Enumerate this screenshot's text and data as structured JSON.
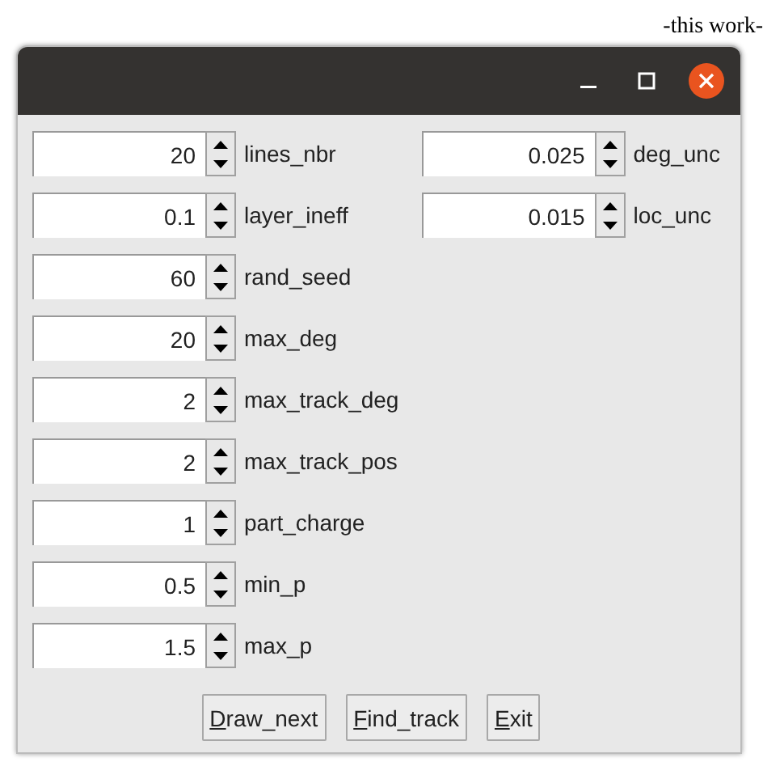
{
  "caption": "-this work-",
  "left_column": [
    {
      "value": "20",
      "label": "lines_nbr"
    },
    {
      "value": "0.1",
      "label": "layer_ineff"
    },
    {
      "value": "60",
      "label": "rand_seed"
    },
    {
      "value": "20",
      "label": "max_deg"
    },
    {
      "value": "2",
      "label": "max_track_deg"
    },
    {
      "value": "2",
      "label": "max_track_pos"
    },
    {
      "value": "1",
      "label": "part_charge"
    },
    {
      "value": "0.5",
      "label": "min_p"
    },
    {
      "value": "1.5",
      "label": "max_p"
    }
  ],
  "right_column": [
    {
      "value": "0.025",
      "label": "deg_unc"
    },
    {
      "value": "0.015",
      "label": "loc_unc"
    }
  ],
  "buttons": [
    "Draw_next",
    "Find_track",
    "Exit"
  ]
}
